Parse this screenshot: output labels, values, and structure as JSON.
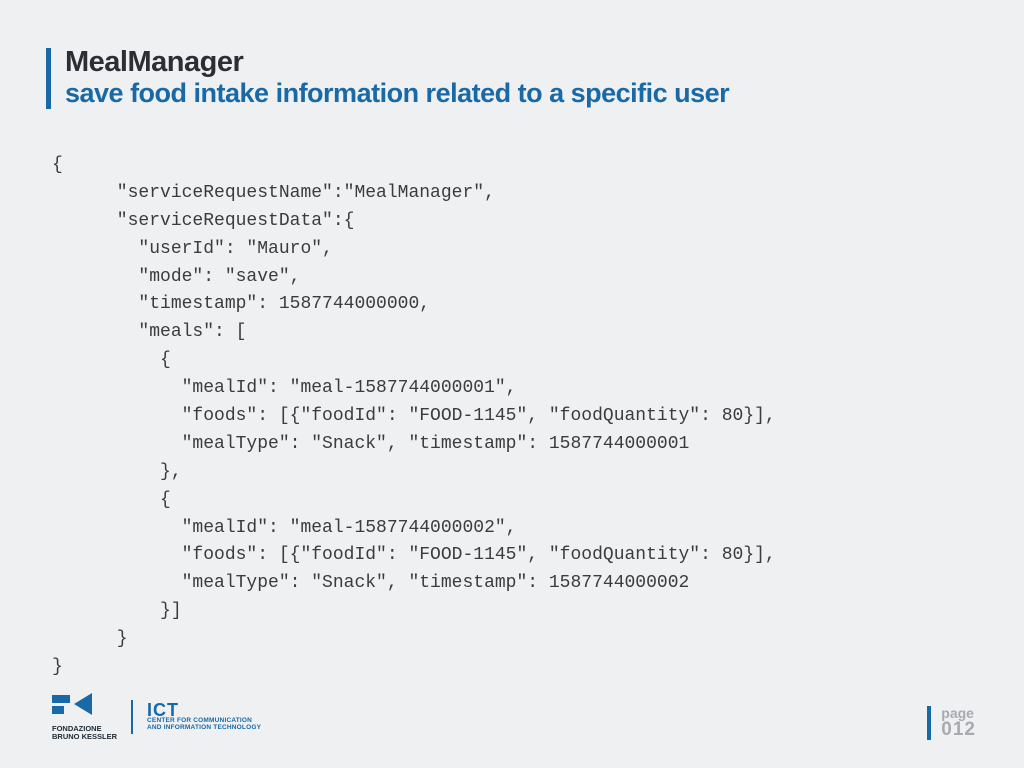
{
  "header": {
    "title": "MealManager",
    "subtitle": "save food intake information related to a specific user"
  },
  "code": "{\n      \"serviceRequestName\":\"MealManager\",\n      \"serviceRequestData\":{\n        \"userId\": \"Mauro\",\n        \"mode\": \"save\",\n        \"timestamp\": 1587744000000,\n        \"meals\": [\n          {\n            \"mealId\": \"meal-1587744000001\",\n            \"foods\": [{\"foodId\": \"FOOD-1145\", \"foodQuantity\": 80}],\n            \"mealType\": \"Snack\", \"timestamp\": 1587744000001\n          },\n          {\n            \"mealId\": \"meal-1587744000002\",\n            \"foods\": [{\"foodId\": \"FOOD-1145\", \"foodQuantity\": 80}],\n            \"mealType\": \"Snack\", \"timestamp\": 1587744000002\n          }]\n      }\n}",
  "footer": {
    "fbk_line1": "FONDAZIONE",
    "fbk_line2": "BRUNO KESSLER",
    "ict": "ICT",
    "ict_sub1": "CENTER FOR COMMUNICATION",
    "ict_sub2": "AND INFORMATION TECHNOLOGY",
    "page_label": "page",
    "page_number": "012"
  }
}
